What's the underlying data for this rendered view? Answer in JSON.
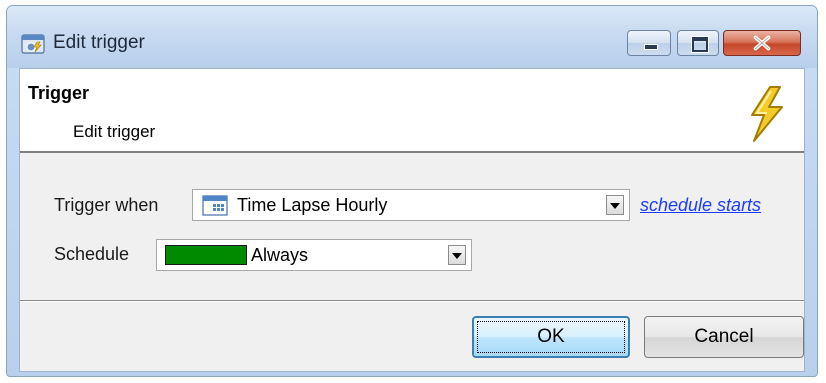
{
  "window": {
    "title": "Edit trigger",
    "app_icon": "trigger-app-icon",
    "controls": {
      "minimize_icon": "minimize-icon",
      "maximize_icon": "maximize-icon",
      "close_icon": "close-icon",
      "close_color": "#c4472a"
    }
  },
  "header": {
    "title": "Trigger",
    "subtitle": "Edit trigger",
    "icon": "lightning-bolt-icon",
    "icon_color": "#f2c21b"
  },
  "form": {
    "trigger_when": {
      "label": "Trigger when",
      "value": "Time Lapse Hourly",
      "icon": "calendar-icon",
      "link_text": "schedule starts"
    },
    "schedule": {
      "label": "Schedule",
      "value": "Always",
      "swatch_color": "#008a00"
    }
  },
  "buttons": {
    "ok_label": "OK",
    "cancel_label": "Cancel"
  },
  "colors": {
    "link": "#1a3cff",
    "titlebar": "#c7daf1",
    "ok_button_border": "#3c7fb1"
  }
}
